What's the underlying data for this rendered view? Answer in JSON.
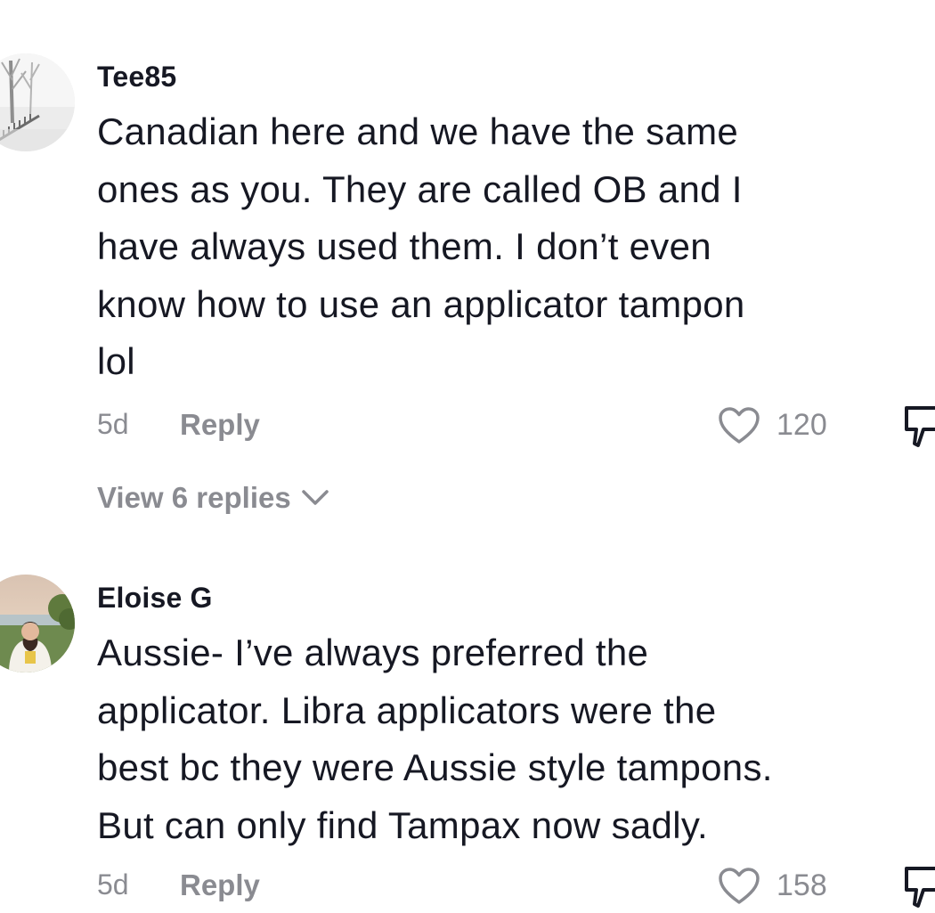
{
  "comments": [
    {
      "username": "Tee85",
      "text_lines": [
        "Canadian here and we have the same",
        "ones as you. They are called OB and I",
        "have always used them. I don’t even",
        "know how to use an applicator tampon",
        "lol"
      ],
      "time": "5d",
      "reply_label": "Reply",
      "likes": "120",
      "view_replies_label": "View 6 replies",
      "avatar_icon": "snowy-park-avatar"
    },
    {
      "username": "Eloise G",
      "text_lines": [
        "Aussie- I’ve always preferred the",
        "applicator. Libra applicators were the",
        "best bc they were Aussie style tampons.",
        "But can only find Tampax now sadly."
      ],
      "time": "5d",
      "reply_label": "Reply",
      "likes": "158",
      "avatar_icon": "beach-portrait-avatar"
    }
  ],
  "colors": {
    "text_primary": "#161823",
    "text_secondary": "#8a8b91",
    "background": "#ffffff"
  }
}
